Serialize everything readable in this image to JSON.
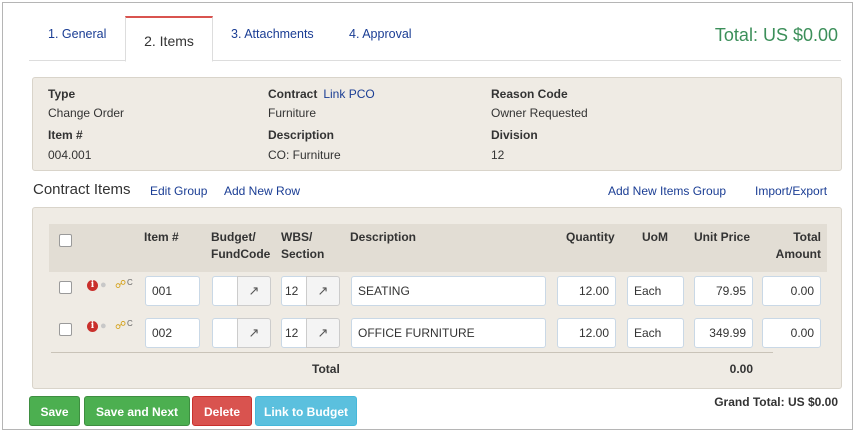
{
  "tabs": [
    {
      "label": "1. General"
    },
    {
      "label": "2. Items"
    },
    {
      "label": "3. Attachments"
    },
    {
      "label": "4. Approval"
    }
  ],
  "total_top": "Total: US $0.00",
  "info": {
    "type_label": "Type",
    "type_value": "Change Order",
    "contract_label": "Contract",
    "contract_link": "Link PCO",
    "contract_value": "Furniture",
    "reason_label": "Reason Code",
    "reason_value": "Owner Requested",
    "item_label": "Item #",
    "item_value": "004.001",
    "description_label": "Description",
    "description_value": "CO: Furniture",
    "division_label": "Division",
    "division_value": "12"
  },
  "contract_items": {
    "title": "Contract Items",
    "edit_group": "Edit Group",
    "add_new_row": "Add New Row",
    "add_new_items_group": "Add New Items Group",
    "import_export": "Import/Export"
  },
  "table": {
    "headers": {
      "item": "Item #",
      "budget": "Budget/\nFundCode",
      "wbs": "WBS/\nSection",
      "description": "Description",
      "quantity": "Quantity",
      "uom": "UoM",
      "unit_price": "Unit Price",
      "total_amount": "Total\nAmount"
    },
    "rows": [
      {
        "item": "001",
        "wbs": "12",
        "description": "SEATING",
        "quantity": "12.00",
        "uom": "Each",
        "unit_price": "79.95",
        "total": "0.00"
      },
      {
        "item": "002",
        "wbs": "12",
        "description": "OFFICE FURNITURE",
        "quantity": "12.00",
        "uom": "Each",
        "unit_price": "349.99",
        "total": "0.00"
      }
    ],
    "total_label": "Total",
    "total_value": "0.00",
    "row_icon_letter": "C"
  },
  "buttons": {
    "save": "Save",
    "save_next": "Save and Next",
    "delete": "Delete",
    "link_budget": "Link to Budget"
  },
  "grand_total": "Grand Total: US $0.00",
  "colors": {
    "green": "#4caf50",
    "red": "#d9534f",
    "blue": "#5bc0de",
    "link": "#1a3d94",
    "total_green": "#3c8f5a"
  },
  "icons": [
    "info-icon",
    "comment-icon",
    "link-icon",
    "external-link-icon",
    "checkbox-icon"
  ]
}
